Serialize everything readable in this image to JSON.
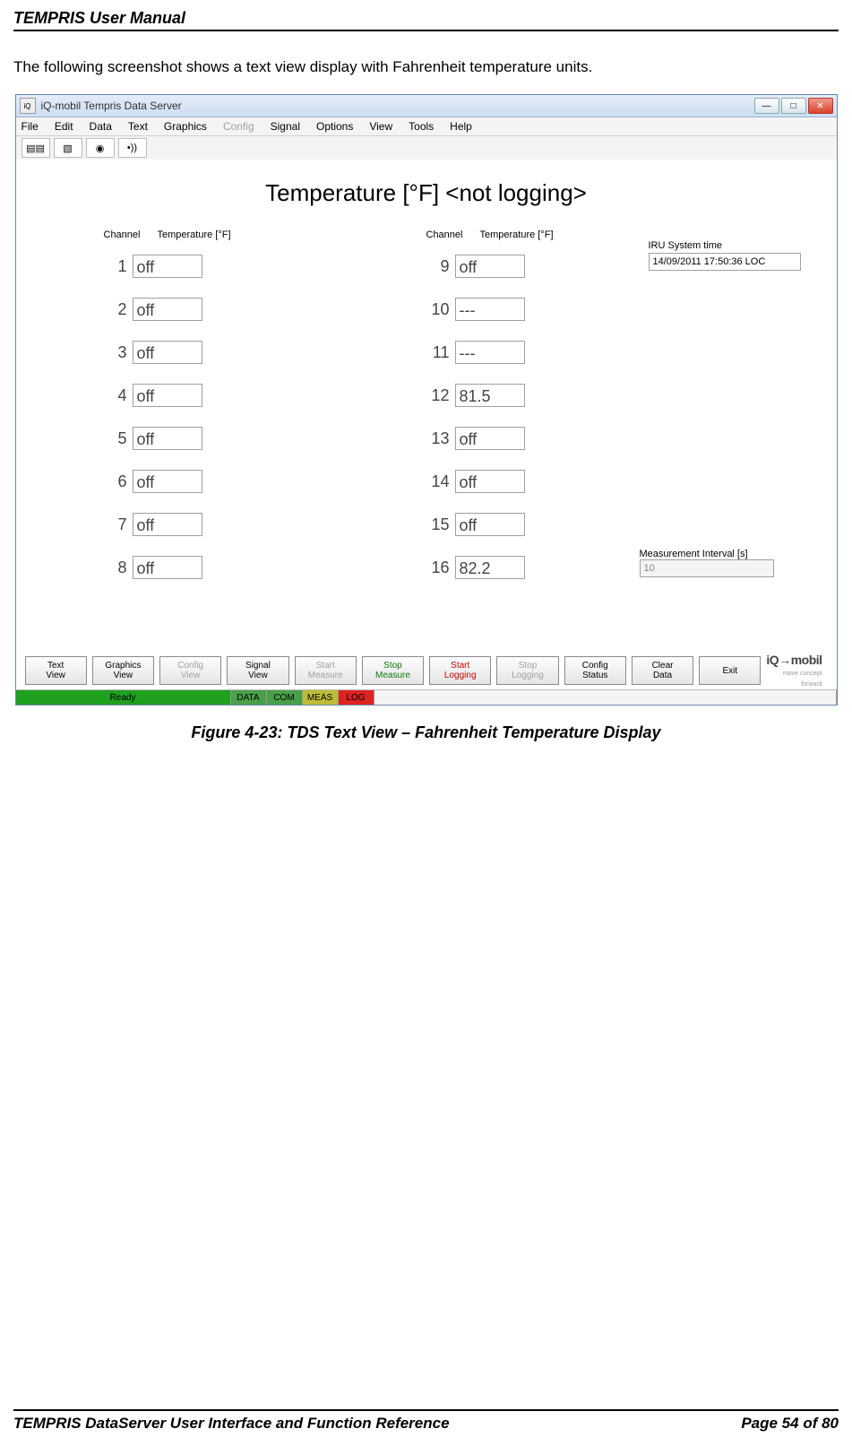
{
  "document": {
    "header_title": "TEMPRIS User Manual",
    "intro": "The following screenshot shows a text view display with Fahrenheit temperature units.",
    "caption": "Figure 4-23: TDS Text View – Fahrenheit Temperature Display",
    "footer_left": "TEMPRIS DataServer User Interface and Function Reference",
    "footer_right": "Page 54 of 80"
  },
  "app": {
    "title": "iQ-mobil Tempris Data Server",
    "app_icon_text": "iQ",
    "menu": {
      "file": "File",
      "edit": "Edit",
      "data": "Data",
      "text": "Text",
      "graphics": "Graphics",
      "config": "Config",
      "signal": "Signal",
      "options": "Options",
      "view": "View",
      "tools": "Tools",
      "help": "Help"
    },
    "toolbar": {
      "btn1": "▤▤",
      "btn2": "▧",
      "btn3": "◉",
      "btn4": "•))"
    },
    "content": {
      "title": "Temperature [°F] <not logging>",
      "col_header_channel": "Channel",
      "col_header_temp": "Temperature [°F]",
      "system_time_label": "IRU System time",
      "system_time_value": "14/09/2011 17:50:36 LOC",
      "interval_label": "Measurement Interval [s]",
      "interval_value": "10",
      "channels_left": [
        {
          "n": "1",
          "v": "off"
        },
        {
          "n": "2",
          "v": "off"
        },
        {
          "n": "3",
          "v": "off"
        },
        {
          "n": "4",
          "v": "off"
        },
        {
          "n": "5",
          "v": "off"
        },
        {
          "n": "6",
          "v": "off"
        },
        {
          "n": "7",
          "v": "off"
        },
        {
          "n": "8",
          "v": "off"
        }
      ],
      "channels_right": [
        {
          "n": "9",
          "v": "off"
        },
        {
          "n": "10",
          "v": "---"
        },
        {
          "n": "11",
          "v": "---"
        },
        {
          "n": "12",
          "v": "81.5"
        },
        {
          "n": "13",
          "v": "off"
        },
        {
          "n": "14",
          "v": "off"
        },
        {
          "n": "15",
          "v": "off"
        },
        {
          "n": "16",
          "v": "82.2"
        }
      ]
    },
    "buttons": {
      "text_view": {
        "l1": "Text",
        "l2": "View"
      },
      "graphics_view": {
        "l1": "Graphics",
        "l2": "View"
      },
      "config_view": {
        "l1": "Config",
        "l2": "View"
      },
      "signal_view": {
        "l1": "Signal",
        "l2": "View"
      },
      "start_measure": {
        "l1": "Start",
        "l2": "Measure"
      },
      "stop_measure": {
        "l1": "Stop",
        "l2": "Measure"
      },
      "start_logging": {
        "l1": "Start",
        "l2": "Logging"
      },
      "stop_logging": {
        "l1": "Stop",
        "l2": "Logging"
      },
      "config_status": {
        "l1": "Config",
        "l2": "Status"
      },
      "clear_data": {
        "l1": "Clear",
        "l2": "Data"
      },
      "exit": {
        "l1": "Exit",
        "l2": ""
      }
    },
    "logo": {
      "main": "iQ→mobil",
      "sub": "move concept forward"
    },
    "status": {
      "ready": "Ready",
      "data": "DATA",
      "com": "COM",
      "meas": "MEAS",
      "log": "LOG"
    },
    "win_buttons": {
      "min": "—",
      "max": "□",
      "close": "✕"
    }
  }
}
